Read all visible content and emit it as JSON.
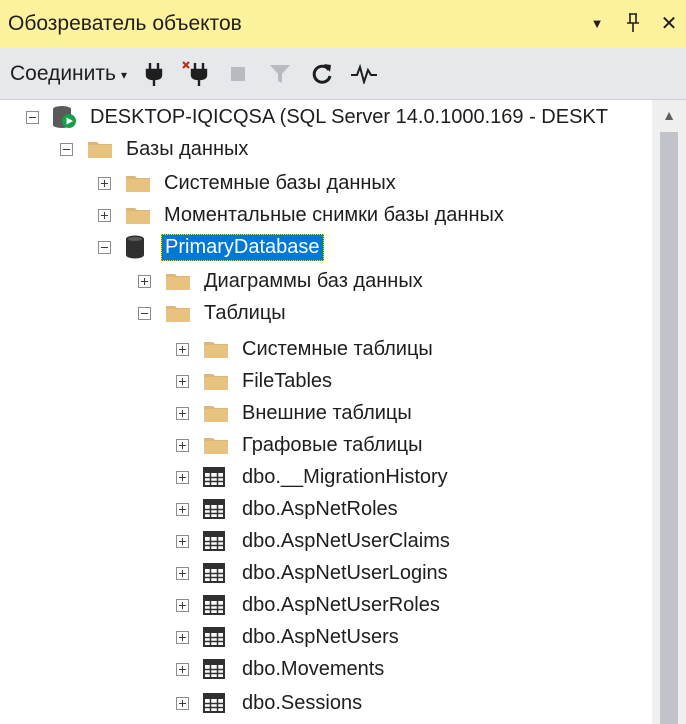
{
  "window": {
    "title": "Обозреватель объектов",
    "buttons": {
      "dropdown": "▼",
      "pin": "ꟼ",
      "close": "✕"
    }
  },
  "toolbar": {
    "connect_label": "Соединить",
    "connect_arrow": "▾",
    "tools": [
      "connect-object-explorer-icon",
      "disconnect-icon",
      "stop-icon",
      "filter-icon",
      "refresh-icon",
      "activity-monitor-icon"
    ]
  },
  "tree": {
    "server": {
      "label": "DESKTOP-IQICQSA (SQL Server 14.0.1000.169 - DESKT"
    },
    "databases_folder": {
      "label": "Базы данных"
    },
    "system_databases": {
      "label": "Системные базы данных"
    },
    "snapshots": {
      "label": "Моментальные снимки базы данных"
    },
    "primary_db": {
      "label": "PrimaryDatabase"
    },
    "diagrams": {
      "label": "Диаграммы баз данных"
    },
    "tables_folder": {
      "label": "Таблицы"
    },
    "tables_children": [
      {
        "label": "Системные таблицы",
        "type": "folder"
      },
      {
        "label": "FileTables",
        "type": "folder"
      },
      {
        "label": "Внешние таблицы",
        "type": "folder"
      },
      {
        "label": "Графовые таблицы",
        "type": "folder"
      },
      {
        "label": "dbo.__MigrationHistory",
        "type": "table"
      },
      {
        "label": "dbo.AspNetRoles",
        "type": "table"
      },
      {
        "label": "dbo.AspNetUserClaims",
        "type": "table"
      },
      {
        "label": "dbo.AspNetUserLogins",
        "type": "table"
      },
      {
        "label": "dbo.AspNetUserRoles",
        "type": "table"
      },
      {
        "label": "dbo.AspNetUsers",
        "type": "table"
      },
      {
        "label": "dbo.Movements",
        "type": "table"
      },
      {
        "label": "dbo.Sessions",
        "type": "table"
      }
    ]
  },
  "colors": {
    "title_bg": "#fff29d",
    "toolbar_bg": "#e7e8ec",
    "selection": "#0078d7",
    "folder": "#dcb67a"
  }
}
